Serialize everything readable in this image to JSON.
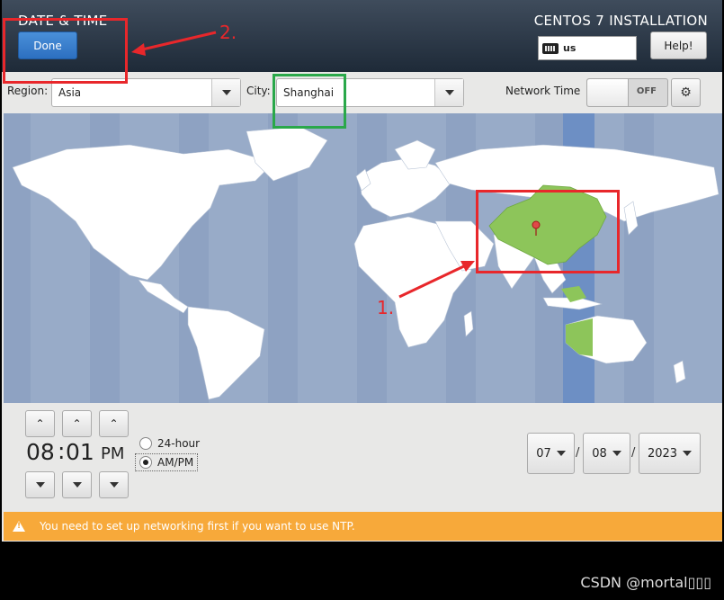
{
  "header": {
    "spoke_title": "DATE & TIME",
    "done_label": "Done",
    "product_title": "CENTOS 7 INSTALLATION",
    "keyboard_layout": "us",
    "help_label": "Help!"
  },
  "toolbar": {
    "region_label": "Region:",
    "region_value": "Asia",
    "city_label": "City:",
    "city_value": "Shanghai",
    "network_time_label": "Network Time",
    "network_time_state": "OFF"
  },
  "map": {
    "ocean_color": "#98abc8",
    "land_color": "#ffffff",
    "selected_zone_color": "#8dc55a",
    "selected_city": "Shanghai"
  },
  "time": {
    "hour": "08",
    "minute": "01",
    "period": "PM",
    "format_24h_label": "24-hour",
    "format_ampm_label": "AM/PM",
    "selected_format": "AM/PM"
  },
  "date": {
    "month": "07",
    "day": "08",
    "year": "2023"
  },
  "warning": {
    "message": "You need to set up networking first if you want to use NTP."
  },
  "annotations": {
    "step1": "1.",
    "step2": "2."
  },
  "watermark": "CSDN @mortal▯▯▯",
  "colors": {
    "header_bg": "#2a3644",
    "done_button": "#3a80d0",
    "warning_bg": "#f7a93a",
    "annotation_red": "#e8272b",
    "annotation_green": "#2aa84a"
  }
}
